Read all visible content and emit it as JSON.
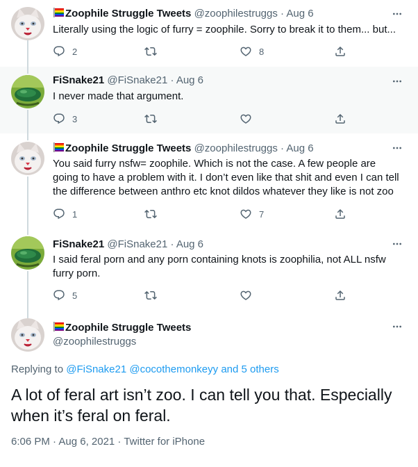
{
  "tweets": [
    {
      "name": "Zoophile Struggle Tweets",
      "meta": " @zoophilestruggs · Aug 6",
      "text": "Literally using the logic of furry = zoophile. Sorry to break it to them... but...",
      "reply_count": "2",
      "retweet_count": "",
      "like_count": "8",
      "avatar": "white-cat-avatar"
    },
    {
      "name": "FiSnake21",
      "meta": " @FiSnake21 · Aug 6",
      "text": "I never made that argument.",
      "reply_count": "3",
      "retweet_count": "",
      "like_count": "",
      "avatar": "green-snake-avatar"
    },
    {
      "name": "Zoophile Struggle Tweets",
      "meta": " @zoophilestruggs · Aug 6",
      "text": "You said furry nsfw= zoophile. Which is not the case. A few people are going to have a problem with it. I don’t even like that shit and even I can tell the difference between anthro etc knot dildos whatever they like is not zoo",
      "reply_count": "1",
      "retweet_count": "",
      "like_count": "7",
      "avatar": "white-cat-avatar"
    },
    {
      "name": "FiSnake21",
      "meta": " @FiSnake21 · Aug 6",
      "text": "I said feral porn and any porn containing knots is zoophilia, not ALL nsfw furry porn.",
      "reply_count": "5",
      "retweet_count": "",
      "like_count": "",
      "avatar": "green-snake-avatar"
    }
  ],
  "main_tweet": {
    "name": "Zoophile Struggle Tweets",
    "handle": "@zoophilestruggs",
    "replying_prefix": "Replying to ",
    "replying_user1": "@FiSnake21",
    "replying_user2": "@cocothemonkeyy",
    "replying_others": "and 5 others",
    "text": "A lot of feral art isn’t zoo. I can tell you that. Especially when it’s feral on feral.",
    "timestamp": "6:06 PM · Aug 6, 2021 · Twitter for iPhone"
  },
  "colors": {
    "text": "#0f1419",
    "secondary": "#536471",
    "link": "#1d9bf0",
    "thread_line": "#cfd9de",
    "shaded_bg": "#f7f9f9"
  },
  "icons": [
    "reply-icon",
    "retweet-icon",
    "like-icon",
    "share-icon",
    "more-icon",
    "rainbow-flag-icon"
  ]
}
